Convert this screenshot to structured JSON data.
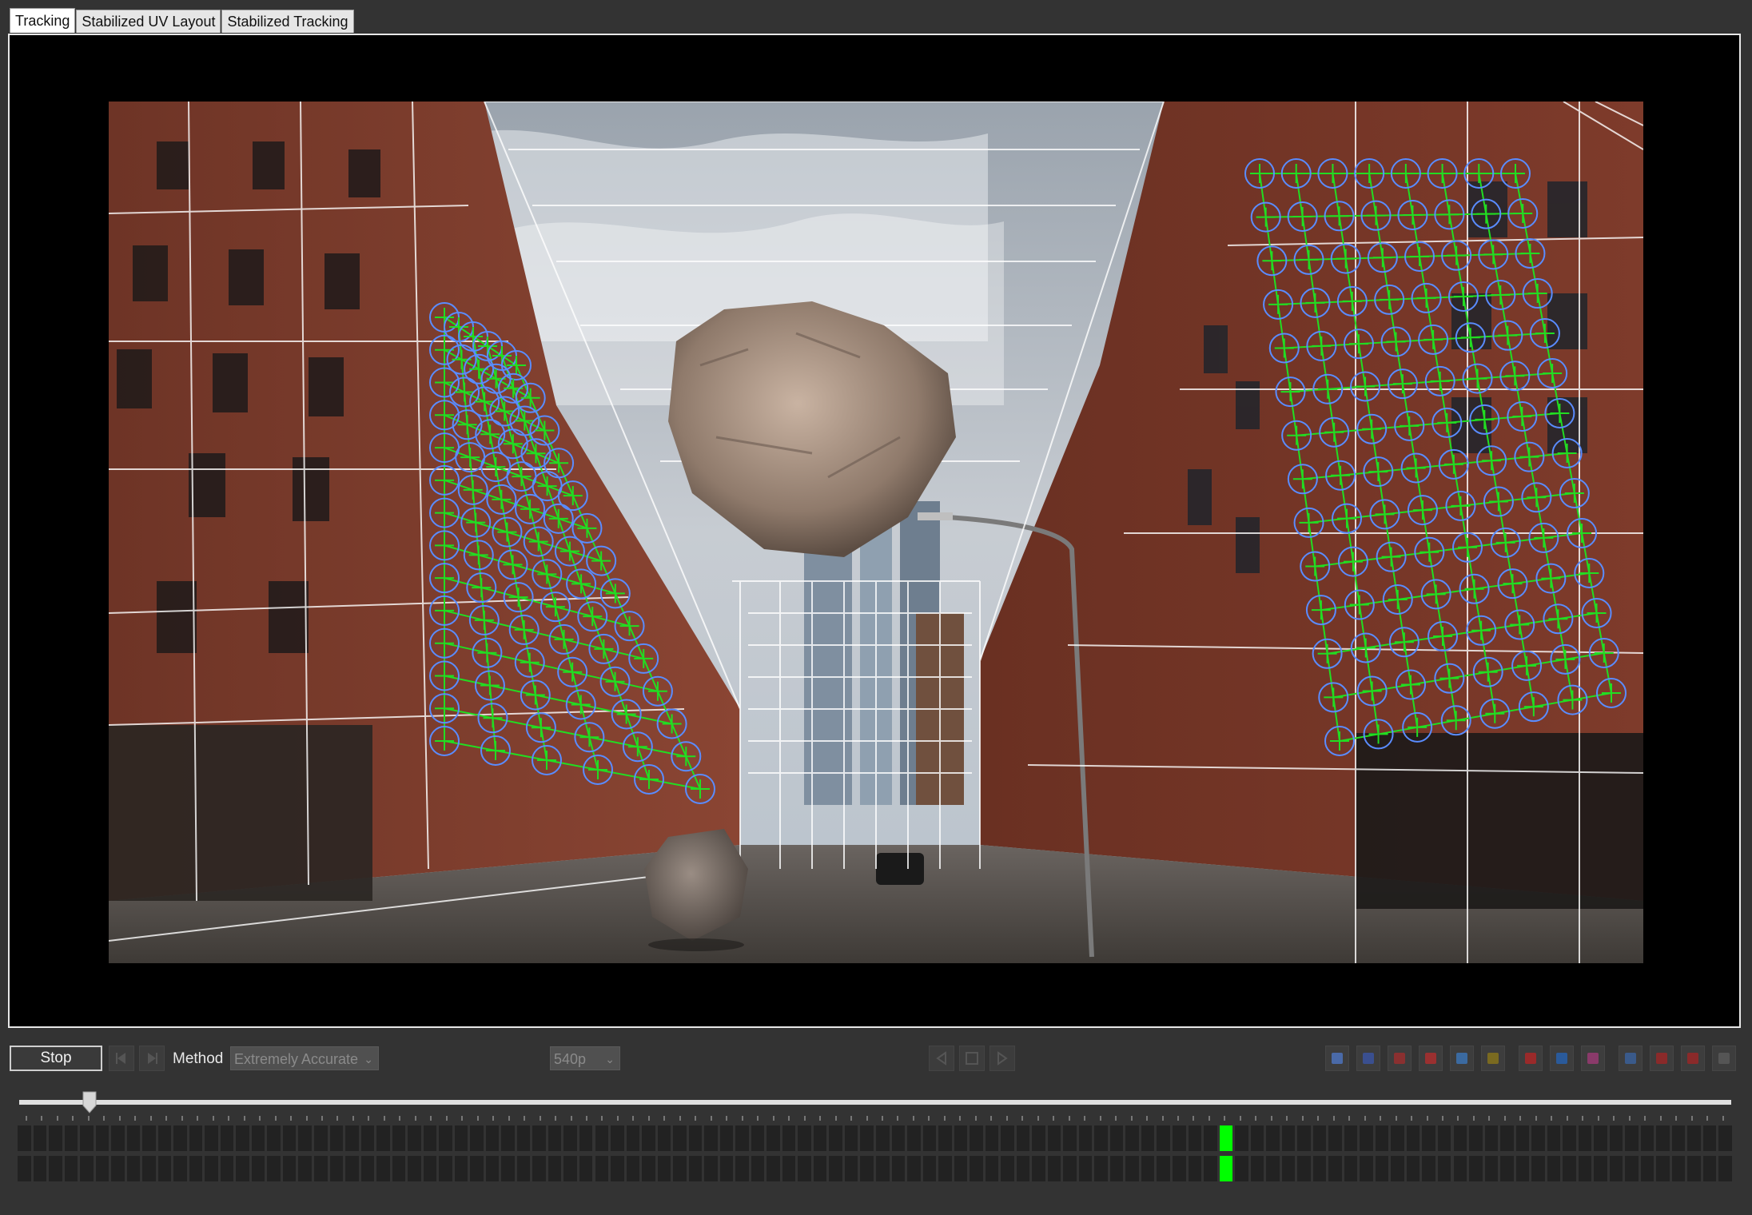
{
  "tabs": [
    "Tracking",
    "Stabilized UV Layout",
    "Stabilized Tracking"
  ],
  "active_tab": 0,
  "viewer": {
    "scene": "city-street-photo",
    "overlay": "tracking-grid-with-points",
    "colors": {
      "grid": "#ffffff",
      "mesh": "#22dd22",
      "points": "#5a8cff"
    }
  },
  "controls": {
    "stop_label": "Stop",
    "method_label": "Method",
    "method_value": "Extremely Accurate",
    "resolution_value": "540p"
  },
  "timeline": {
    "playhead_fraction": 0.041,
    "cell_count": 110,
    "active_cell": 77,
    "active_color": "#00ff00"
  },
  "toolbar_icons": [
    {
      "name": "track-object-icon",
      "color": "#4a6aa8"
    },
    {
      "name": "select-points-icon",
      "color": "#3a4f8f"
    },
    {
      "name": "remove-points-icon",
      "color": "#8a3030"
    },
    {
      "name": "lock-points-icon",
      "color": "#9a3030"
    },
    {
      "name": "pin-points-icon",
      "color": "#3b6aa0"
    },
    {
      "name": "mask-icon",
      "color": "#7a6a20"
    },
    {
      "name": "grid-red-icon",
      "color": "#9a2a2a"
    },
    {
      "name": "grid-blue-icon",
      "color": "#2a5a9a"
    },
    {
      "name": "grid-mixed-icon",
      "color": "#8a3a6a"
    },
    {
      "name": "align-icon",
      "color": "#3a5a8a"
    },
    {
      "name": "move-icon",
      "color": "#8a2a2a"
    },
    {
      "name": "scale-icon",
      "color": "#8a2a2a"
    },
    {
      "name": "more-icon",
      "color": "#555555"
    }
  ]
}
